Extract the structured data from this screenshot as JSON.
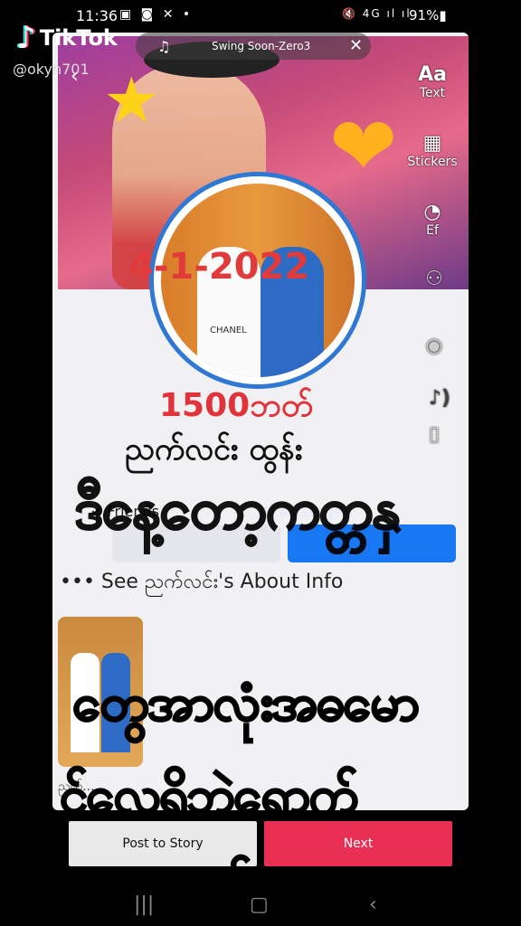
{
  "status_bar": {
    "time": "11:36",
    "left_icons": "▣ ◙ ✕ •",
    "right_icons": "🔇 4G ıl ıl",
    "battery": "91%▮"
  },
  "watermark": {
    "brand": "TikTok",
    "handle": "@okyh701"
  },
  "music": {
    "song": "Swing Soon-Zero3"
  },
  "side_tools": {
    "text_icon": "Aa",
    "text_label": "Text",
    "stickers_label": "Stickers",
    "effects_label": "Ef"
  },
  "post": {
    "date": "4-1-2022",
    "amount": "1500ဘတ်",
    "name": "ညက်လင်း ထွန်း",
    "follow_label": "✔ Friends",
    "message_label": "✉ Message",
    "about": "••• See ညက်လင်း's About Info",
    "thumb_label": "ညက်..."
  },
  "captions": {
    "line1": "ဒီနေ့တော့ကတ္တနှ",
    "line2": "တွေအာလုံးအဓမော",
    "line3": "င်လေရှိဘဲရောက်",
    "line4": "တယ်နော"
  },
  "actions": {
    "post_to_story": "Post to Story",
    "next": "Next"
  },
  "navbar": {
    "recent": "|||",
    "home": "▢",
    "back": "‹"
  },
  "colors": {
    "accent_next": "#ea2f55",
    "facebook_blue": "#1877f2"
  }
}
